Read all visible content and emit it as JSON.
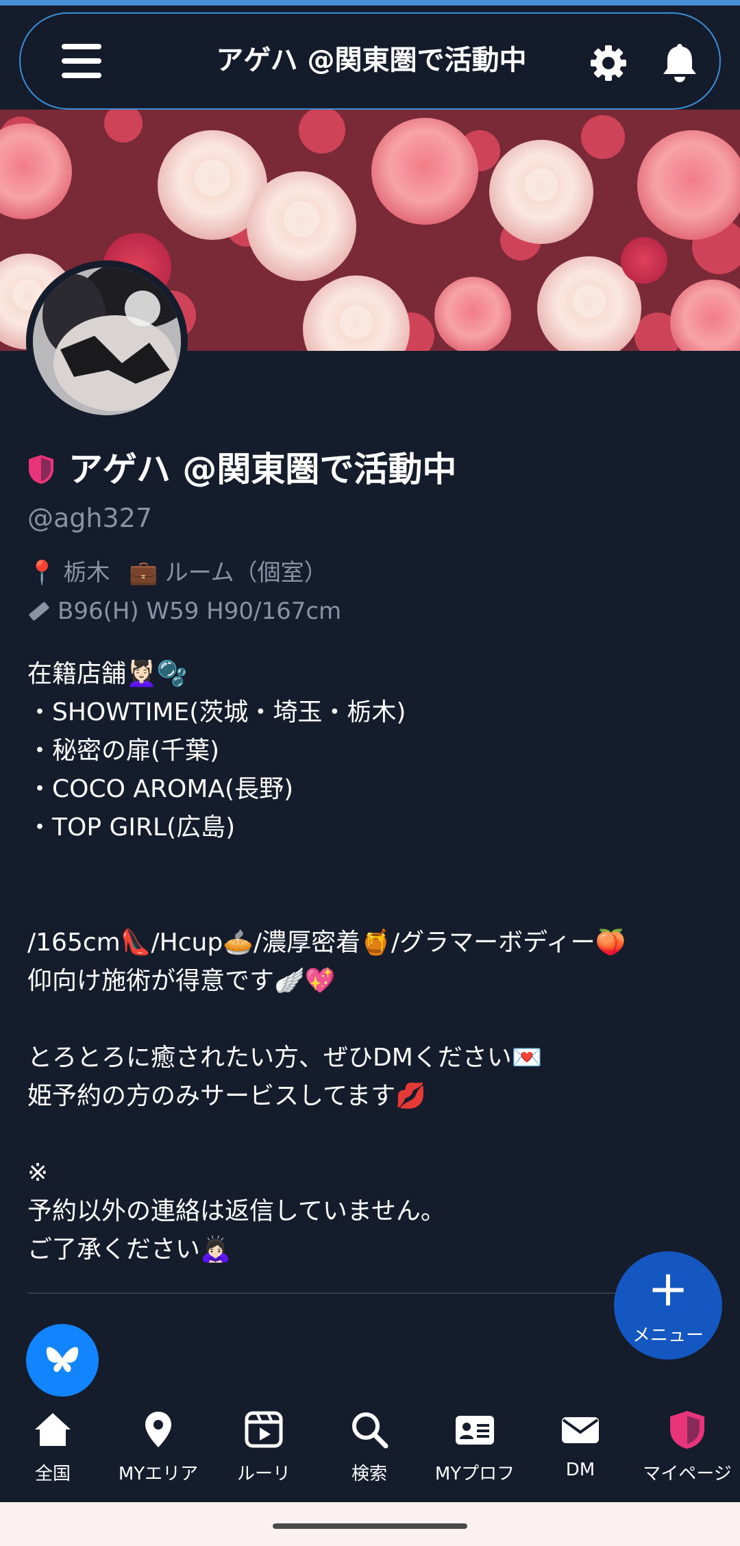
{
  "header": {
    "title": "アゲハ @関東圏で活動中",
    "menu_icon": "hamburger-menu-icon",
    "settings_icon": "gear-icon",
    "notifications_icon": "bell-icon"
  },
  "profile": {
    "display_name": "アゲハ @関東圏で活動中",
    "handle": "@agh327",
    "badge_icon": "pink-shield-icon",
    "location_icon": "📍",
    "location": "栃木",
    "type_icon": "💼",
    "service_type": "ルーム（個室）",
    "measure_icon": "ruler-icon",
    "measurements": "B96(H) W59 H90/167cm"
  },
  "bio_lines": [
    "在籍店舗💆🏻‍♀️🫧",
    "・SHOWTIME(茨城・埼玉・栃木)",
    "・秘密の扉(千葉)",
    "・COCO AROMA(長野)",
    "・TOP GIRL(広島)",
    "",
    "",
    "/165cm👠/Hcup🥧/濃厚密着🍯/グラマーボディー🍑",
    "仰向け施術が得意です🪽💖",
    "",
    "とろとろに癒されたい方、ぜひDMください💌",
    "姫予約の方のみサービスしてます💋",
    "",
    "※",
    "予約以外の連絡は返信していません。",
    "ご了承ください🙇🏻‍♀️"
  ],
  "fab": {
    "plus": "+",
    "label": "メニュー"
  },
  "bluesky_icon": "butterfly-icon",
  "bottom_nav": [
    {
      "label": "全国",
      "icon": "home-icon"
    },
    {
      "label": "MYエリア",
      "icon": "map-pin-icon"
    },
    {
      "label": "ルーリ",
      "icon": "video-icon"
    },
    {
      "label": "検索",
      "icon": "search-icon"
    },
    {
      "label": "MYプロフ",
      "icon": "profile-card-icon"
    },
    {
      "label": "DM",
      "icon": "mail-icon"
    },
    {
      "label": "マイページ",
      "icon": "shield-icon"
    }
  ],
  "colors": {
    "background": "#151c2c",
    "header_border": "#3b8fd6",
    "muted_text": "#8a93a4",
    "fab": "#1557c0",
    "bluesky": "#1184fe",
    "badge_pink": "#e8357a"
  }
}
